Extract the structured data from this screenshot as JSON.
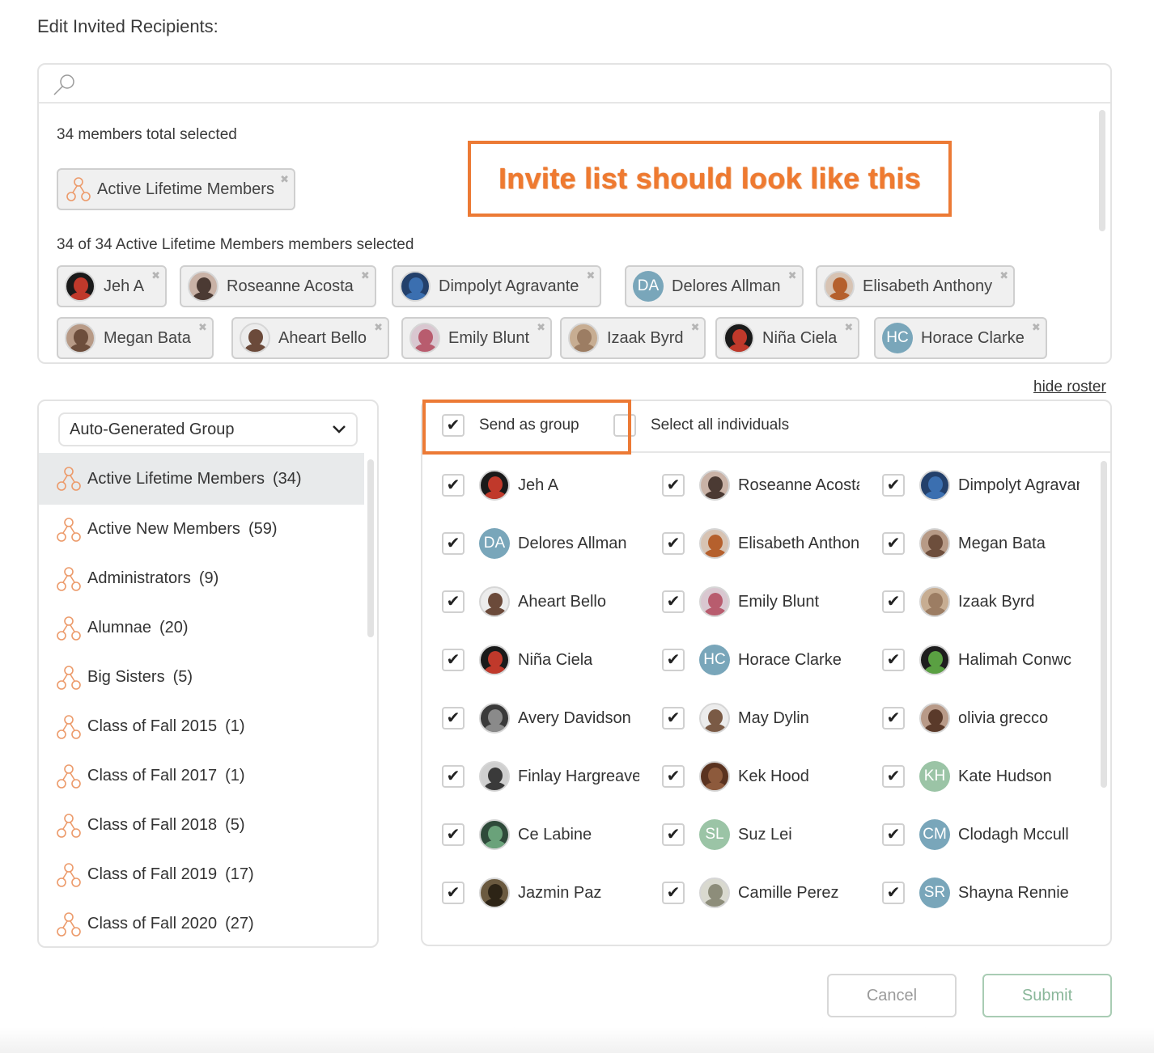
{
  "page": {
    "title": "Edit Invited Recipients:"
  },
  "search": {
    "placeholder": ""
  },
  "selection": {
    "total_text": "34 members total selected",
    "group_chip": "Active Lifetime Members",
    "subset_text": "34 of 34 Active Lifetime Members members selected",
    "member_chips": [
      {
        "name": "Jeh A",
        "avatar": "photo",
        "color": "#1a1a1a",
        "accent": "#c0392b"
      },
      {
        "name": "Roseanne Acosta",
        "avatar": "photo",
        "color": "#c9b2a6",
        "accent": "#4b3a33"
      },
      {
        "name": "Dimpolyt Agravante",
        "avatar": "photo",
        "color": "#23406b",
        "accent": "#3b6fb0"
      },
      {
        "name": "Delores Allman",
        "avatar": "initials",
        "initials": "DA",
        "color": "#79a6ba"
      },
      {
        "name": "Elisabeth Anthony",
        "avatar": "photo",
        "color": "#d7c3b3",
        "accent": "#b5602d"
      },
      {
        "name": "Megan Bata",
        "avatar": "photo",
        "color": "#b79a86",
        "accent": "#6d4e3c"
      },
      {
        "name": "Aheart Bello",
        "avatar": "photo",
        "color": "#ececec",
        "accent": "#6b4a3a"
      },
      {
        "name": "Emily Blunt",
        "avatar": "photo",
        "color": "#d9c7d0",
        "accent": "#b85c6e"
      },
      {
        "name": "Izaak Byrd",
        "avatar": "photo",
        "color": "#c7ad92",
        "accent": "#9c7d63"
      },
      {
        "name": "Niña Ciela",
        "avatar": "photo",
        "color": "#1a1a1a",
        "accent": "#c0392b"
      },
      {
        "name": "Horace Clarke",
        "avatar": "initials",
        "initials": "HC",
        "color": "#79a6ba"
      }
    ]
  },
  "annotation": {
    "text": "Invite list should look like this",
    "color": "#ec7a35"
  },
  "hide_roster_label": "hide roster",
  "groups": {
    "dropdown_value": "Auto-Generated Group",
    "items": [
      {
        "label": "Active Lifetime Members",
        "count": "(34)",
        "active": true
      },
      {
        "label": "Active New Members",
        "count": "(59)"
      },
      {
        "label": "Administrators",
        "count": "(9)"
      },
      {
        "label": "Alumnae",
        "count": "(20)"
      },
      {
        "label": "Big Sisters",
        "count": "(5)"
      },
      {
        "label": "Class of Fall 2015",
        "count": "(1)"
      },
      {
        "label": "Class of Fall 2017",
        "count": "(1)"
      },
      {
        "label": "Class of Fall 2018",
        "count": "(5)"
      },
      {
        "label": "Class of Fall 2019",
        "count": "(17)"
      },
      {
        "label": "Class of Fall 2020",
        "count": "(27)"
      }
    ]
  },
  "roster": {
    "send_as_group_label": "Send as group",
    "send_as_group_checked": true,
    "select_all_label": "Select all individuals",
    "select_all_checked": false,
    "members": [
      {
        "name": "Jeh A",
        "avatar": "photo",
        "color": "#1a1a1a",
        "accent": "#c0392b",
        "checked": true
      },
      {
        "name": "Roseanne Acosta",
        "avatar": "photo",
        "color": "#c9b2a6",
        "accent": "#4b3a33",
        "checked": true
      },
      {
        "name": "Dimpolyt Agravante",
        "avatar": "photo",
        "color": "#23406b",
        "accent": "#3b6fb0",
        "checked": true
      },
      {
        "name": "Delores Allman",
        "avatar": "initials",
        "initials": "DA",
        "color": "#79a6ba",
        "checked": true
      },
      {
        "name": "Elisabeth Anthony",
        "avatar": "photo",
        "color": "#d7c3b3",
        "accent": "#b5602d",
        "checked": true
      },
      {
        "name": "Megan Bata",
        "avatar": "photo",
        "color": "#b79a86",
        "accent": "#6d4e3c",
        "checked": true
      },
      {
        "name": "Aheart Bello",
        "avatar": "photo",
        "color": "#ececec",
        "accent": "#6b4a3a",
        "checked": true
      },
      {
        "name": "Emily Blunt",
        "avatar": "photo",
        "color": "#d9c7d0",
        "accent": "#b85c6e",
        "checked": true
      },
      {
        "name": "Izaak Byrd",
        "avatar": "photo",
        "color": "#c7ad92",
        "accent": "#9c7d63",
        "checked": true
      },
      {
        "name": "Niña Ciela",
        "avatar": "photo",
        "color": "#1a1a1a",
        "accent": "#c0392b",
        "checked": true
      },
      {
        "name": "Horace Clarke",
        "avatar": "initials",
        "initials": "HC",
        "color": "#79a6ba",
        "checked": true
      },
      {
        "name": "Halimah Conwc",
        "avatar": "photo",
        "color": "#1e1e1e",
        "accent": "#5aa042",
        "checked": true
      },
      {
        "name": "Avery Davidson",
        "avatar": "photo",
        "color": "#3a3a3a",
        "accent": "#8a8a8a",
        "checked": true
      },
      {
        "name": "May Dylin",
        "avatar": "photo",
        "color": "#ececec",
        "accent": "#7a5a45",
        "checked": true
      },
      {
        "name": "olivia grecco",
        "avatar": "photo",
        "color": "#b89a88",
        "accent": "#5a3a2a",
        "checked": true
      },
      {
        "name": "Finlay Hargreave",
        "avatar": "photo",
        "color": "#cfcfcf",
        "accent": "#3a3a3a",
        "checked": true
      },
      {
        "name": "Kek Hood",
        "avatar": "photo",
        "color": "#5a3320",
        "accent": "#8d5a3c",
        "checked": true
      },
      {
        "name": "Kate Hudson",
        "avatar": "initials",
        "initials": "KH",
        "color": "#9bc4a6",
        "checked": true
      },
      {
        "name": "Ce Labine",
        "avatar": "photo",
        "color": "#2f4a3a",
        "accent": "#6aa27a",
        "checked": true
      },
      {
        "name": "Suz Lei",
        "avatar": "initials",
        "initials": "SL",
        "color": "#9bc4a6",
        "checked": true
      },
      {
        "name": "Clodagh Mccull",
        "avatar": "initials",
        "initials": "CM",
        "color": "#79a6ba",
        "checked": true
      },
      {
        "name": "Jazmin Paz",
        "avatar": "photo",
        "color": "#6b5a40",
        "accent": "#2d2416",
        "checked": true
      },
      {
        "name": "Camille Perez",
        "avatar": "photo",
        "color": "#d9d9cf",
        "accent": "#8d8d7a",
        "checked": true
      },
      {
        "name": "Shayna Rennie",
        "avatar": "initials",
        "initials": "SR",
        "color": "#79a6ba",
        "checked": true
      }
    ]
  },
  "buttons": {
    "cancel": "Cancel",
    "submit": "Submit"
  }
}
